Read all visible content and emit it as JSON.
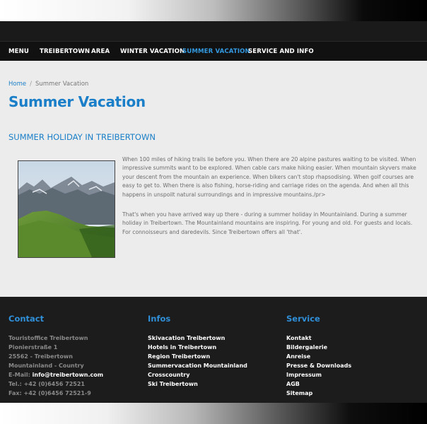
{
  "nav": {
    "items": [
      {
        "label": "MENU"
      },
      {
        "label": "TREIBERTOWN"
      },
      {
        "label": "AREA"
      },
      {
        "label": "WINTER VACATION"
      },
      {
        "label": "SUMMER VACATION",
        "active": true
      },
      {
        "label": "SERVICE AND INFO"
      }
    ]
  },
  "breadcrumb": {
    "home": "Home",
    "separator": "/",
    "current": "Summer Vacation"
  },
  "page": {
    "title": "Summer Vacation",
    "section_title": "SUMMER HOLIDAY IN TREIBERTOWN",
    "paragraph1": "When 100 miles of hiking trails lie before you. When there are 20 alpine pastures waiting to be visited. When impressive summits want to be explored. When cable cars make hiking easier. When mountain skyvers make your descent from the mountain an experience. When bikers can't stop rhapsodising. When golf courses are easy to get to. When there is also fishing, horse-riding and carriage rides on the agenda. And when all this happens in unspoilt natural surroundings and in impressive mountains./pr>",
    "paragraph2": "That's when you have arrived way up there - during a summer holiday in Mountainland. During a summer holiday in Treibertown. The Mountainland mountains are inspiring. For young and old. For guests and locals. For connoisseurs and daredevils. Since Treibertown offers all 'that'."
  },
  "footer": {
    "contact": {
      "heading": "Contact",
      "lines": [
        "Touristoffice Treibertown",
        "Pionierstraße 1",
        "25562 - Treibertown",
        "Mountainland - Country"
      ],
      "email_label": "E-Mail:",
      "email": "info@treibertown.com",
      "tel": "Tel.: +42 (0)6456 72521",
      "fax": "Fax: +42 (0)6456 72521-9"
    },
    "infos": {
      "heading": "Infos",
      "links": [
        "Skivacation Treibertown",
        "Hotels in Treibertown",
        "Region Treibertown",
        "Summervacation Mountainland",
        "Crosscountry",
        "Ski Treibertown"
      ]
    },
    "service": {
      "heading": "Service",
      "links": [
        "Kontakt",
        "Bildergalerie",
        "Anreise",
        "Presse & Downloads",
        "Impressum",
        "AGB",
        "Sitemap"
      ]
    }
  },
  "colors": {
    "accent": "#1a7fc8",
    "nav_active": "#3399e0",
    "footer_bg": "#1c1c1c",
    "content_bg": "#ececec"
  }
}
